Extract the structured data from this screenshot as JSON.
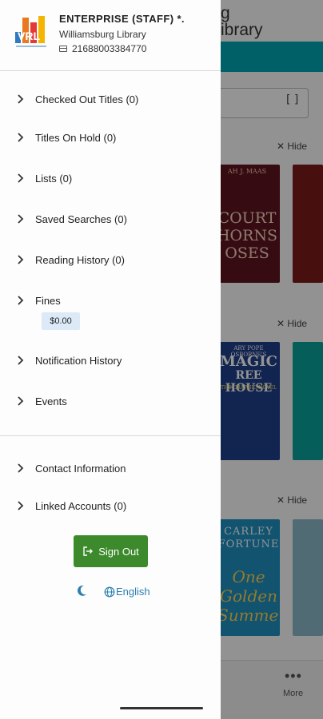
{
  "background": {
    "title_line1": "g",
    "title_line2": "ibrary",
    "hide_label": "Hide",
    "covers": [
      {
        "line1": "AH J. MAAS",
        "line2": "COURT",
        "line3": "HORNS",
        "line4": "OSES"
      },
      {
        "line1": "ARY POPE OSBORNE'S",
        "line2": "MAGIC",
        "line3": "REE HOUSE",
        "line4": "THE GRAPHIC NOVEL"
      },
      {
        "line1": "CARLEY",
        "line2": "FORTUNE",
        "line3": "One",
        "line4": "Golden",
        "line5": "Summer"
      }
    ],
    "more_label": "More",
    "colors": {
      "banner": "#00a6b4"
    }
  },
  "drawer": {
    "institution": "ENTERPRISE (STAFF) *.",
    "library": "Williamsburg Library",
    "card_number": "21688003384770",
    "menu_primary": [
      {
        "label": "Checked Out Titles (0)",
        "icon": "chevron-right-icon"
      },
      {
        "label": "Titles On Hold (0)",
        "icon": "chevron-right-icon"
      },
      {
        "label": "Lists (0)",
        "icon": "chevron-right-icon"
      },
      {
        "label": "Saved Searches (0)",
        "icon": "chevron-right-icon"
      },
      {
        "label": "Reading History (0)",
        "icon": "chevron-right-icon"
      },
      {
        "label": "Fines",
        "icon": "chevron-right-icon"
      },
      {
        "label": "Notification History",
        "icon": "chevron-right-icon"
      },
      {
        "label": "Events",
        "icon": "chevron-right-icon"
      }
    ],
    "fines_amount": "$0.00",
    "menu_secondary": [
      {
        "label": "Contact Information",
        "icon": "chevron-right-icon"
      },
      {
        "label": "Linked Accounts (0)",
        "icon": "chevron-right-icon"
      }
    ],
    "sign_out_label": "Sign Out",
    "language_label": "English",
    "colors": {
      "sign_out": "#3c8a2c",
      "language": "#2a7fb0",
      "fines_badge": "#dceaf8"
    }
  }
}
